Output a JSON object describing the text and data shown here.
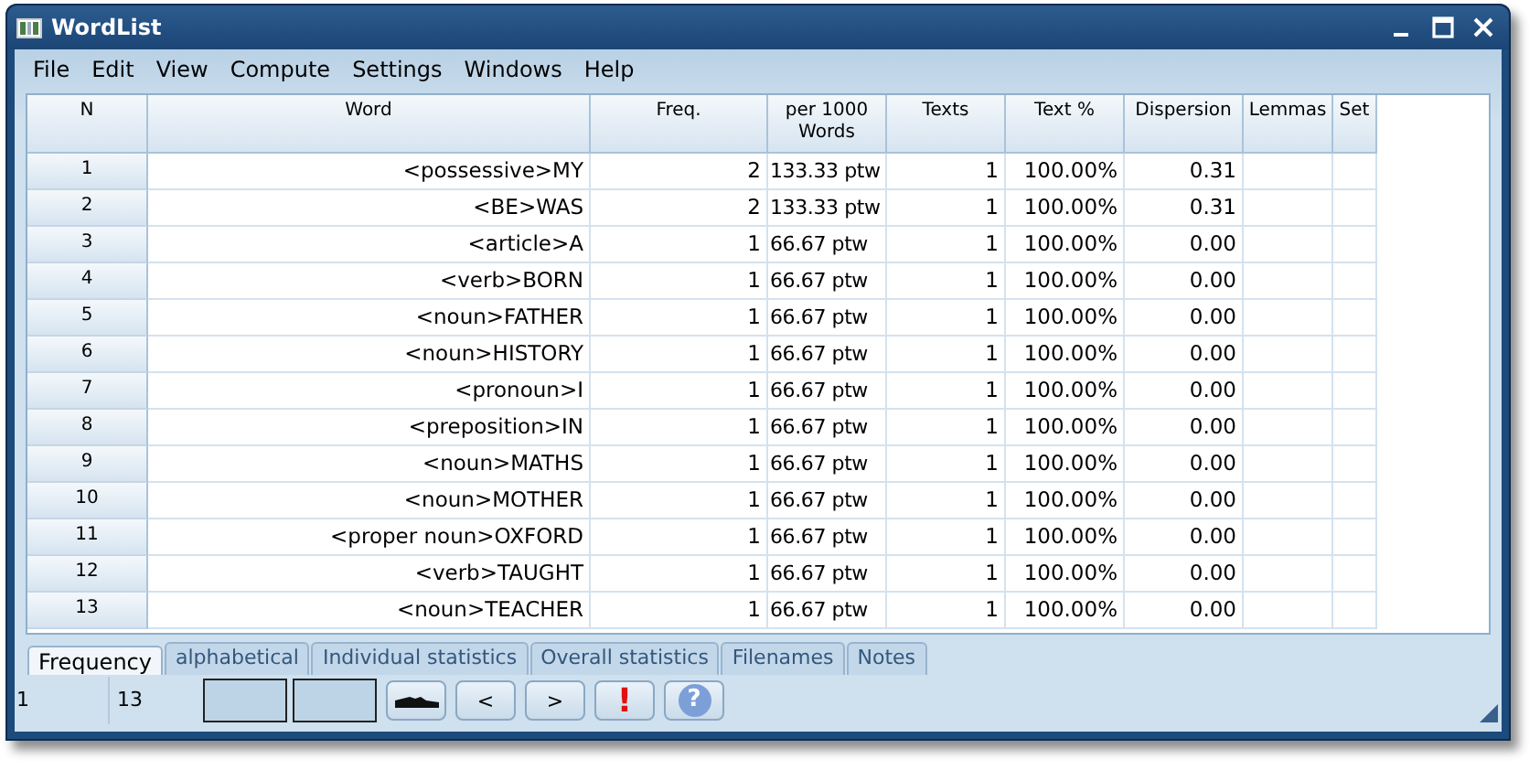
{
  "window": {
    "title": "WordList"
  },
  "menu": [
    "File",
    "Edit",
    "View",
    "Compute",
    "Settings",
    "Windows",
    "Help"
  ],
  "table": {
    "columns": [
      "N",
      "Word",
      "Freq.",
      "per 1000 Words",
      "Texts",
      "Text %",
      "Dispersion",
      "Lemmas",
      "Set"
    ],
    "rows": [
      [
        "1",
        "<possessive>MY",
        "2",
        "133.33 ptw",
        "1",
        "100.00%",
        "0.31",
        "",
        ""
      ],
      [
        "2",
        "<BE>WAS",
        "2",
        "133.33 ptw",
        "1",
        "100.00%",
        "0.31",
        "",
        ""
      ],
      [
        "3",
        "<article>A",
        "1",
        "66.67 ptw",
        "1",
        "100.00%",
        "0.00",
        "",
        ""
      ],
      [
        "4",
        "<verb>BORN",
        "1",
        "66.67 ptw",
        "1",
        "100.00%",
        "0.00",
        "",
        ""
      ],
      [
        "5",
        "<noun>FATHER",
        "1",
        "66.67 ptw",
        "1",
        "100.00%",
        "0.00",
        "",
        ""
      ],
      [
        "6",
        "<noun>HISTORY",
        "1",
        "66.67 ptw",
        "1",
        "100.00%",
        "0.00",
        "",
        ""
      ],
      [
        "7",
        "<pronoun>I",
        "1",
        "66.67 ptw",
        "1",
        "100.00%",
        "0.00",
        "",
        ""
      ],
      [
        "8",
        "<preposition>IN",
        "1",
        "66.67 ptw",
        "1",
        "100.00%",
        "0.00",
        "",
        ""
      ],
      [
        "9",
        "<noun>MATHS",
        "1",
        "66.67 ptw",
        "1",
        "100.00%",
        "0.00",
        "",
        ""
      ],
      [
        "10",
        "<noun>MOTHER",
        "1",
        "66.67 ptw",
        "1",
        "100.00%",
        "0.00",
        "",
        ""
      ],
      [
        "11",
        "<proper noun>OXFORD",
        "1",
        "66.67 ptw",
        "1",
        "100.00%",
        "0.00",
        "",
        ""
      ],
      [
        "12",
        "<verb>TAUGHT",
        "1",
        "66.67 ptw",
        "1",
        "100.00%",
        "0.00",
        "",
        ""
      ],
      [
        "13",
        "<noun>TEACHER",
        "1",
        "66.67 ptw",
        "1",
        "100.00%",
        "0.00",
        "",
        ""
      ]
    ]
  },
  "tabs": [
    {
      "label": "Frequency",
      "selected": true
    },
    {
      "label": "alphabetical",
      "selected": false
    },
    {
      "label": "Individual statistics",
      "selected": false
    },
    {
      "label": "Overall statistics",
      "selected": false
    },
    {
      "label": "Filenames",
      "selected": false
    },
    {
      "label": "Notes",
      "selected": false
    }
  ],
  "status_bar": {
    "cell_1": "1",
    "cell_2": "13",
    "buttons": [
      {
        "kind": "shoe"
      },
      {
        "kind": "text",
        "label": "<"
      },
      {
        "kind": "text",
        "label": ">"
      },
      {
        "kind": "alert",
        "label": "!"
      },
      {
        "kind": "help",
        "label": "?"
      }
    ]
  }
}
